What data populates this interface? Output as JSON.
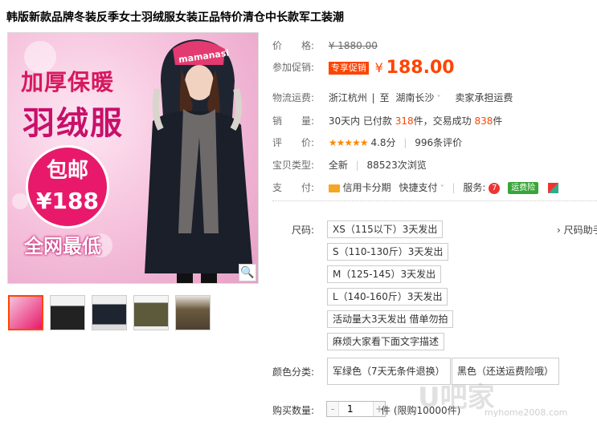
{
  "product": {
    "title": "韩版新款品牌冬装反季女士羽绒服女装正品特价清仓中长款军工装潮"
  },
  "main_image": {
    "ad_line1": "加厚保暖",
    "ad_line2": "羽绒服",
    "ad_baoyou": "包邮",
    "ad_price": "¥188",
    "ad_line3": "全网最低",
    "cap_text": "mamanasi"
  },
  "details": {
    "price_label": "价　　格:",
    "price_original": "¥ 1880.00",
    "promo_label": "参加促销:",
    "promo_badge": "专享促销",
    "promo_yen": "¥",
    "promo_price": "188.00",
    "shipping_label": "物流运费:",
    "ship_from": "浙江杭州",
    "ship_to_prefix": "至",
    "ship_to": "湖南长沙",
    "ship_fee": "卖家承担运费",
    "sales_label": "销　　量:",
    "sales_prefix": "30天内 已付款",
    "sales_paid": "318",
    "sales_mid": "件，交易成功",
    "sales_success": "838",
    "sales_suffix": "件",
    "rating_label": "评　　价:",
    "rating_stars": "★★★★★",
    "rating_score": "4.8分",
    "rating_count": "996条评价",
    "type_label": "宝贝类型:",
    "type_value": "全新",
    "views": "88523次浏览",
    "pay_label": "支　　付:",
    "pay_credit": "信用卡分期",
    "pay_quick": "快捷支付",
    "service_label": "服务:",
    "service_badge": "运费险"
  },
  "sku": {
    "size_label": "尺码:",
    "size_guide": "尺码助手",
    "sizes": [
      "XS（115以下）3天发出",
      "S（110-130斤）3天发出",
      "M（125-145）3天发出",
      "L（140-160斤）3天发出",
      "活动量大3天发出 借单勿拍",
      "麻烦大家看下面文字描述"
    ],
    "color_label": "颜色分类:",
    "colors": [
      "军绿色（7天无条件退换）",
      "黑色（还送运费险哦）"
    ],
    "qty_label": "购买数量:",
    "qty_value": "1",
    "qty_minus": "-",
    "qty_plus": "+",
    "qty_suffix": "件 (限购10000件)"
  },
  "watermark": {
    "main": "U吧家",
    "url": "myhome2008.com"
  },
  "colors": {
    "accent": "#ff4400",
    "ad_pink": "#e8196b",
    "badge_green": "#3aa53a"
  }
}
